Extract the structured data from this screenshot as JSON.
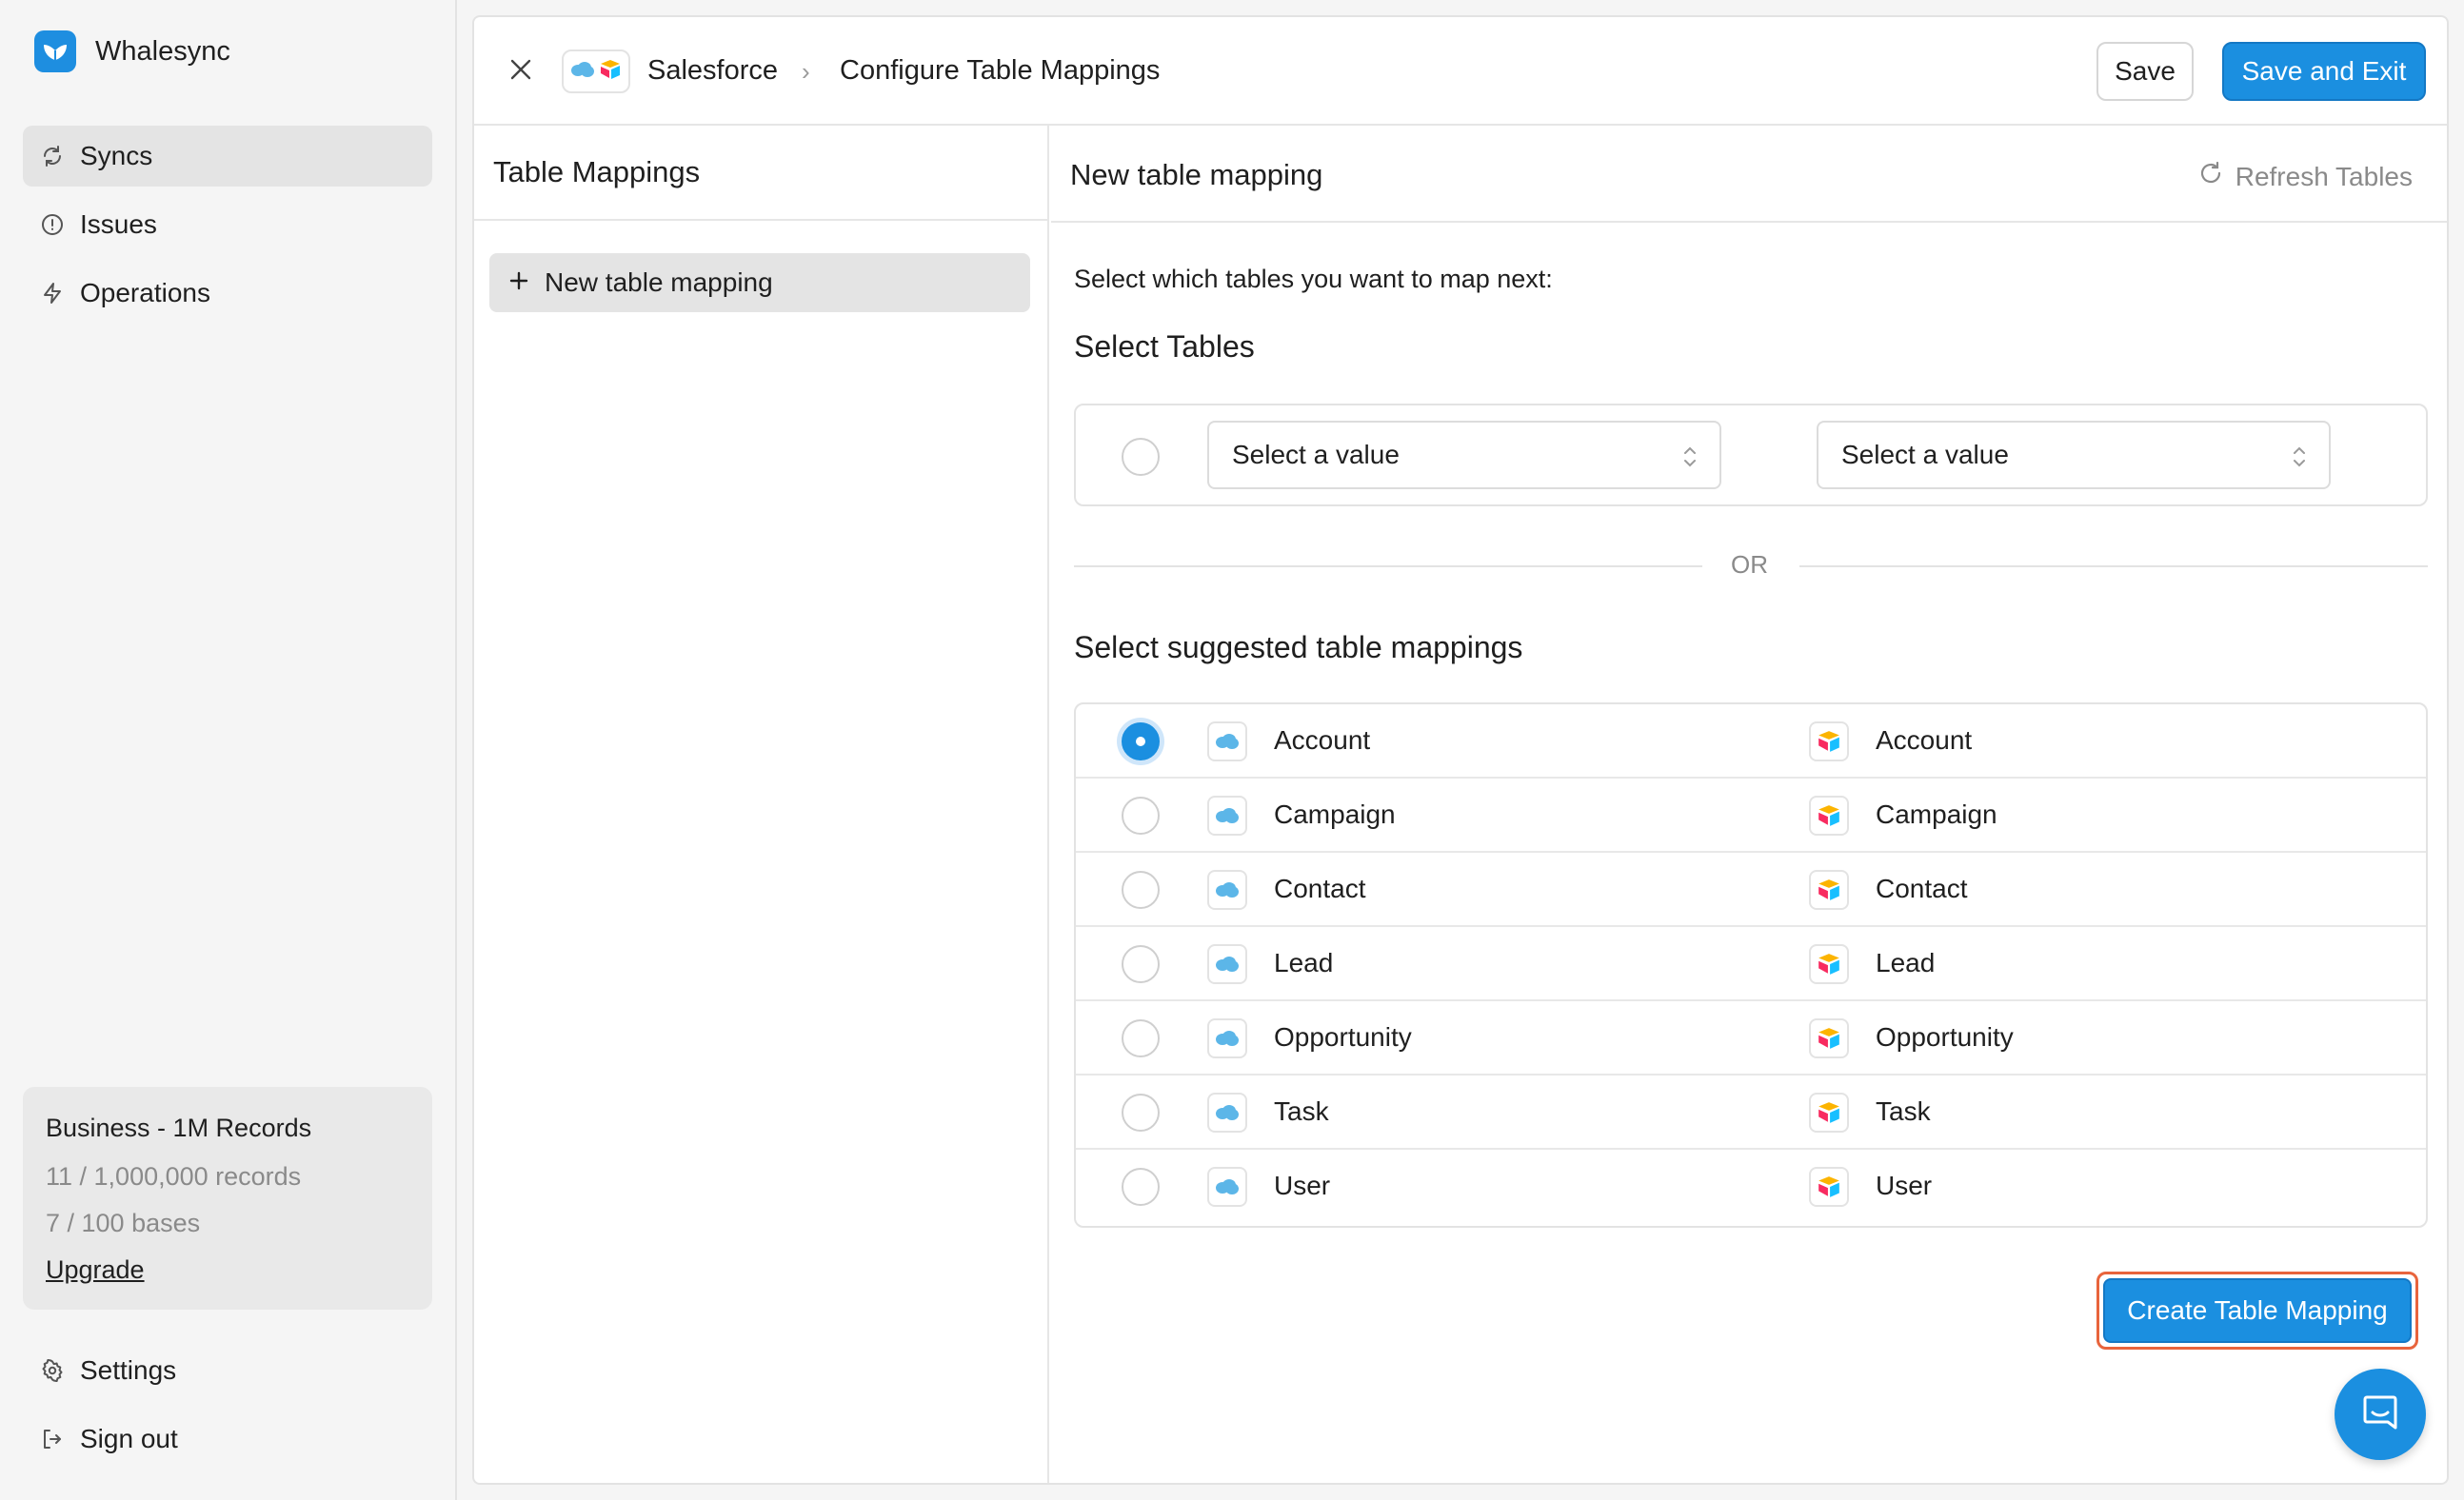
{
  "app": {
    "name": "Whalesync"
  },
  "sidebar": {
    "nav": [
      {
        "label": "Syncs",
        "icon": "refresh-icon",
        "active": true
      },
      {
        "label": "Issues",
        "icon": "alert-circle-icon",
        "active": false
      },
      {
        "label": "Operations",
        "icon": "lightning-icon",
        "active": false
      }
    ],
    "plan": {
      "title": "Business - 1M Records",
      "records": "11 / 1,000,000 records",
      "bases": "7 / 100 bases",
      "upgrade": "Upgrade"
    },
    "bottom": [
      {
        "label": "Settings",
        "icon": "gear-icon"
      },
      {
        "label": "Sign out",
        "icon": "sign-out-icon"
      }
    ]
  },
  "header": {
    "breadcrumb_app": "Salesforce",
    "breadcrumb_sep": "›",
    "breadcrumb_page": "Configure Table Mappings",
    "save_label": "Save",
    "save_exit_label": "Save and Exit"
  },
  "left_panel": {
    "title": "Table Mappings",
    "new_mapping_label": "New table mapping"
  },
  "right_panel": {
    "title": "New table mapping",
    "refresh_label": "Refresh Tables",
    "instruction": "Select which tables you want to map next:",
    "select_tables_title": "Select Tables",
    "select_left_placeholder": "Select a value",
    "select_right_placeholder": "Select a value",
    "or_label": "OR",
    "suggested_title": "Select suggested table mappings",
    "suggested": [
      {
        "left": "Account",
        "right": "Account",
        "selected": true
      },
      {
        "left": "Campaign",
        "right": "Campaign",
        "selected": false
      },
      {
        "left": "Contact",
        "right": "Contact",
        "selected": false
      },
      {
        "left": "Lead",
        "right": "Lead",
        "selected": false
      },
      {
        "left": "Opportunity",
        "right": "Opportunity",
        "selected": false
      },
      {
        "left": "Task",
        "right": "Task",
        "selected": false
      },
      {
        "left": "User",
        "right": "User",
        "selected": false
      }
    ],
    "create_label": "Create Table Mapping"
  },
  "colors": {
    "accent": "#1b8fe0",
    "highlight": "#e8643c",
    "salesforce": "#5cb6e8",
    "airtable_yellow": "#fcb400",
    "airtable_red": "#f82b60",
    "airtable_blue": "#18bfff"
  }
}
